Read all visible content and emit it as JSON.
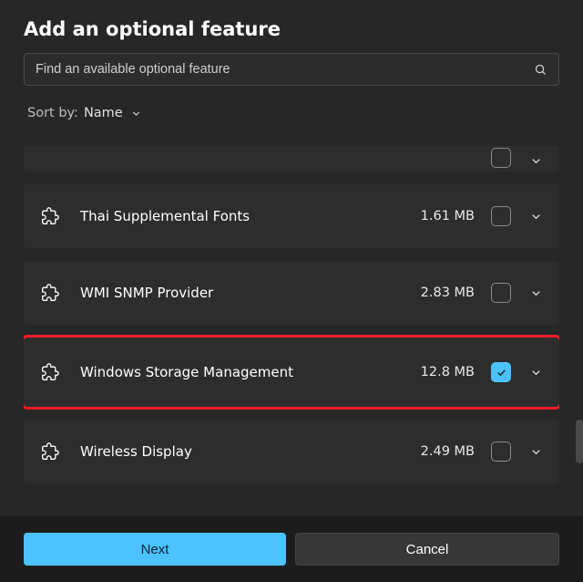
{
  "dialog": {
    "title": "Add an optional feature"
  },
  "search": {
    "placeholder": "Find an available optional feature"
  },
  "sort": {
    "label": "Sort by:",
    "value": "Name"
  },
  "features": [
    {
      "name": "Thai Supplemental Fonts",
      "size": "1.61 MB",
      "checked": false,
      "highlight": false
    },
    {
      "name": "WMI SNMP Provider",
      "size": "2.83 MB",
      "checked": false,
      "highlight": false
    },
    {
      "name": "Windows Storage Management",
      "size": "12.8 MB",
      "checked": true,
      "highlight": true
    },
    {
      "name": "Wireless Display",
      "size": "2.49 MB",
      "checked": false,
      "highlight": false
    }
  ],
  "buttons": {
    "next": "Next",
    "cancel": "Cancel"
  },
  "colors": {
    "accent": "#4cc2ff",
    "highlight_border": "#ee1c25",
    "surface": "#272727",
    "row": "#2d2d2d",
    "footer": "#1c1c1c"
  }
}
